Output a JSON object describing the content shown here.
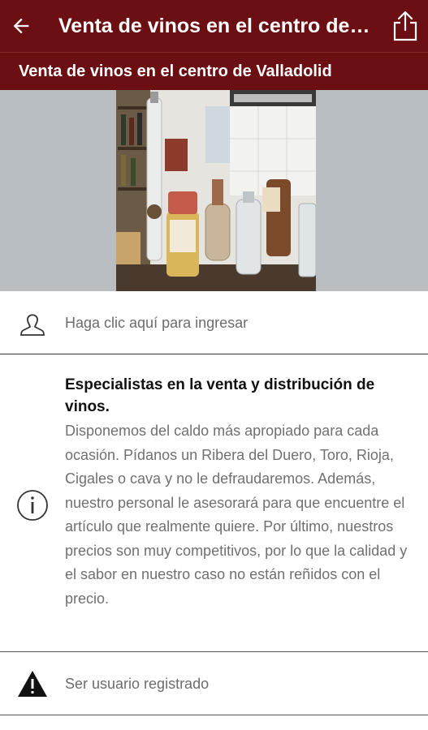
{
  "appbar": {
    "title": "Venta de vinos en el centro de Valladolid",
    "back_icon": "arrow-left-icon",
    "share_icon": "share-icon"
  },
  "subtitle": "Venta de vinos en el centro de Valladolid",
  "hero": {
    "image": "wine-bottles-photo"
  },
  "login": {
    "icon": "person-outline-icon",
    "text": "Haga clic aquí para ingresar"
  },
  "info": {
    "icon": "info-circle-icon",
    "heading": "Especialistas en la venta y distribución de vinos.",
    "body": "Disponemos del caldo más apropiado para cada ocasión. Pídanos un Ribera del Duero, Toro, Rioja, Cigales o cava y no le defraudaremos. Además, nuestro personal le asesorará para que encuentre el artículo que realmente quiere. Por último, nuestros precios son muy competitivos, por lo que la calidad y el sabor en nuestro caso no están reñidos con el precio."
  },
  "register": {
    "icon": "warning-triangle-icon",
    "text": "Ser usuario registrado"
  },
  "colors": {
    "brand": "#6b0f12",
    "muted_text": "#707070"
  }
}
